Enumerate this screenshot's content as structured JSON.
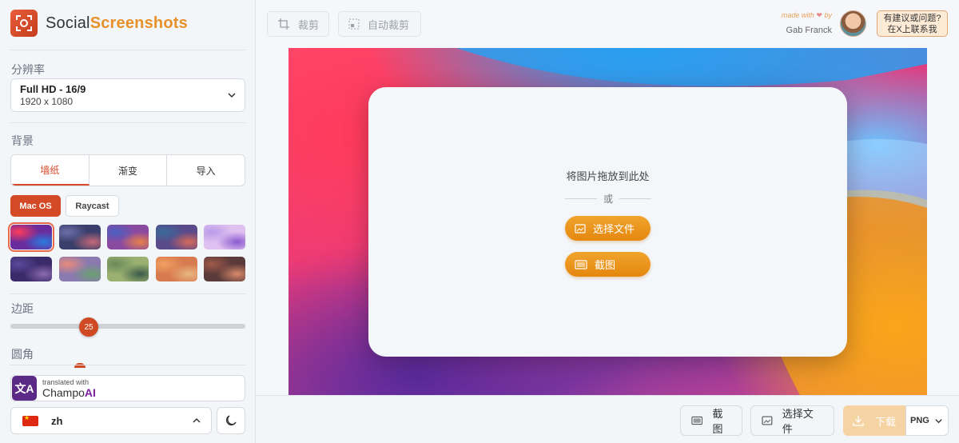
{
  "app": {
    "name_part1": "Social",
    "name_part2": "Screenshots"
  },
  "sidebar": {
    "resolution_label": "分辨率",
    "resolution": {
      "title": "Full HD - 16/9",
      "size": "1920 x 1080"
    },
    "background_label": "背景",
    "bg_tabs": [
      "墙纸",
      "渐变",
      "导入"
    ],
    "active_bg_tab": "墙纸",
    "wallpaper_sets": [
      "Mac OS",
      "Raycast"
    ],
    "active_set": "Mac OS",
    "wallpapers": [
      {
        "name": "wallpaper-1",
        "c1": "#ff3b5c",
        "c2": "#2a7be0",
        "c3": "#6a2c9c"
      },
      {
        "name": "wallpaper-2",
        "c1": "#6b6fa8",
        "c2": "#c56a7a",
        "c3": "#3a3e6a"
      },
      {
        "name": "wallpaper-3",
        "c1": "#4a5fc0",
        "c2": "#e8804a",
        "c3": "#8a4aa0"
      },
      {
        "name": "wallpaper-4",
        "c1": "#3a6a9a",
        "c2": "#d86a5a",
        "c3": "#5a4a8a"
      },
      {
        "name": "wallpaper-5",
        "c1": "#b89ae8",
        "c2": "#8a5ad0",
        "c3": "#e0c0f0"
      },
      {
        "name": "wallpaper-6",
        "c1": "#5a4a9a",
        "c2": "#8a6ab0",
        "c3": "#3a2a6a"
      },
      {
        "name": "wallpaper-7",
        "c1": "#e88a7a",
        "c2": "#6aa070",
        "c3": "#8a7ab0"
      },
      {
        "name": "wallpaper-8",
        "c1": "#6a8a5a",
        "c2": "#3a5a4a",
        "c3": "#9ab070"
      },
      {
        "name": "wallpaper-9",
        "c1": "#f0a060",
        "c2": "#e8b880",
        "c3": "#d87a50"
      },
      {
        "name": "wallpaper-10",
        "c1": "#a05a4a",
        "c2": "#d88a6a",
        "c3": "#5a3a3a"
      }
    ],
    "padding_label": "边距",
    "padding_value": "25",
    "radius_label": "圆角",
    "champo_small": "translated with",
    "champo_name1": "Champo",
    "champo_name2": "AI",
    "champo_icon": "文A",
    "language": "zh"
  },
  "toolbar": {
    "crop": "裁剪",
    "auto_crop": "自动裁剪"
  },
  "credit": {
    "made_with": "made with",
    "by": "by",
    "author": "Gab Franck"
  },
  "feedback": {
    "line1": "有建议或问题?",
    "line2": "在X上联系我"
  },
  "dropzone": {
    "text": "将图片拖放到此处",
    "or": "或",
    "choose_file": "选择文件",
    "screenshot": "截图"
  },
  "bottom": {
    "screenshot": "截图",
    "choose_file": "选择文件",
    "download": "下载",
    "format": "PNG"
  },
  "colors": {
    "accent": "#d54a26",
    "orange": "#e8912a"
  }
}
